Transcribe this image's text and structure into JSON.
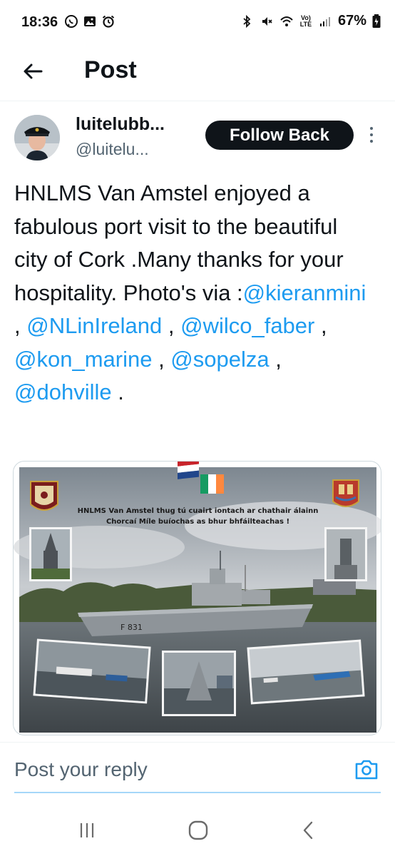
{
  "status_bar": {
    "time": "18:36",
    "battery": "67%",
    "network_label": "Vo) LTE",
    "left_icons": [
      "whatsapp-icon",
      "gallery-icon",
      "alarm-icon"
    ],
    "right_icons": [
      "bluetooth-icon",
      "mute-icon",
      "wifi-icon",
      "signal-icon",
      "battery-icon"
    ]
  },
  "header": {
    "title": "Post",
    "back_icon": "arrow-left-icon"
  },
  "author": {
    "display_name": "luitelubb...",
    "handle": "@luitelu...",
    "follow_label": "Follow Back",
    "more_icon": "more-vertical-icon"
  },
  "post": {
    "text_segments": [
      {
        "text": "HNLMS Van Amstel enjoyed a fabulous port visit to the beautiful city of Cork .Many thanks for your hospitality. Photo's via :",
        "mention": false
      },
      {
        "text": "@kieranmini",
        "mention": true
      },
      {
        "text": " , ",
        "mention": false
      },
      {
        "text": "@NLinIreland",
        "mention": true
      },
      {
        "text": " , ",
        "mention": false
      },
      {
        "text": "@wilco_faber",
        "mention": true
      },
      {
        "text": " , ",
        "mention": false
      },
      {
        "text": "@kon_marine",
        "mention": true
      },
      {
        "text": " , ",
        "mention": false
      },
      {
        "text": "@sopelza",
        "mention": true
      },
      {
        "text": " , ",
        "mention": false
      },
      {
        "text": "@dohville",
        "mention": true
      },
      {
        "text": " .",
        "mention": false
      }
    ]
  },
  "media": {
    "banner_line1": "HNLMS Van Amstel thug tú cuairt iontach ar chathair álainn",
    "banner_line2": "Chorcaí Míle buíochas as bhur bhfáilteachas !",
    "hull_number": "F 831"
  },
  "reply": {
    "placeholder": "Post your reply",
    "camera_icon": "camera-icon"
  },
  "nav": {
    "icons": [
      "recent-apps-icon",
      "home-icon",
      "back-icon"
    ]
  },
  "colors": {
    "accent": "#1d9bf0",
    "text": "#0f1419",
    "secondary": "#536471",
    "button_bg": "#0f1419"
  }
}
